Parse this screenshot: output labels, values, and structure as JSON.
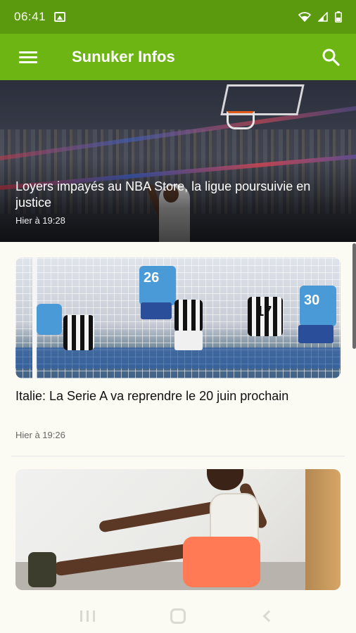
{
  "status_bar": {
    "time": "06:41"
  },
  "app_bar": {
    "title": "Sunuker Infos"
  },
  "featured": {
    "title": "Loyers impayés au NBA Store, la ligue poursuivie en justice",
    "time": "Hier à 19:28"
  },
  "articles": [
    {
      "title": "Italie: La Serie A va reprendre le 20 juin prochain",
      "time": "Hier à 19:26",
      "jersey_numbers": [
        "26",
        "17",
        "30"
      ]
    }
  ],
  "colors": {
    "status_bar": "#5b9a0f",
    "app_bar": "#6db512",
    "background": "#fbfbf3"
  },
  "icons": {
    "menu": "menu-icon",
    "search": "search-icon",
    "wifi": "wifi-icon",
    "signal": "signal-icon",
    "battery": "battery-icon",
    "gallery": "image-icon"
  }
}
